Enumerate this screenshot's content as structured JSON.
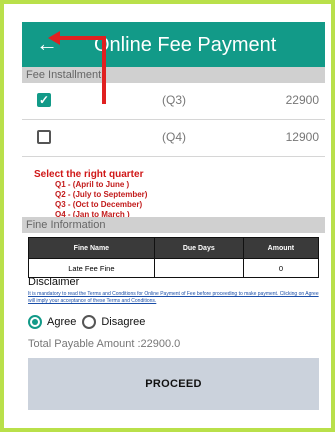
{
  "app": {
    "title": "Online Fee Payment",
    "back_icon": "back-arrow-icon",
    "accent": "#129a88",
    "frame": "#b9e04a"
  },
  "fee_installment": {
    "header": "Fee Installment",
    "rows": [
      {
        "checked": true,
        "quarter": "(Q3)",
        "amount": "22900"
      },
      {
        "checked": false,
        "quarter": "(Q4)",
        "amount": "12900"
      }
    ]
  },
  "annotation": {
    "heading": "Select the right quarter",
    "lines": [
      "Q1 - (April to June )",
      "Q2 - (July to September)",
      "Q3 - (Oct to December)",
      "Q4 - (Jan to March )"
    ],
    "color": "#d01818"
  },
  "fine_information": {
    "header": "Fine Information",
    "columns": [
      "Fine Name",
      "Due Days",
      "Amount"
    ],
    "rows": [
      [
        "Late Fee Fine",
        "",
        "0"
      ]
    ]
  },
  "disclaimer": {
    "title": "Disclaimer",
    "text": "It is mandatory to read the Terms and Conditions for Online Payment of Fee before proceeding to make payment. Clicking on Agree will imply your acceptance of these Terms and Conditions."
  },
  "consent": {
    "agree_label": "Agree",
    "disagree_label": "Disagree",
    "selected": "Agree"
  },
  "total": {
    "text": "Total Payable Amount :22900.0"
  },
  "actions": {
    "proceed_label": "PROCEED"
  }
}
